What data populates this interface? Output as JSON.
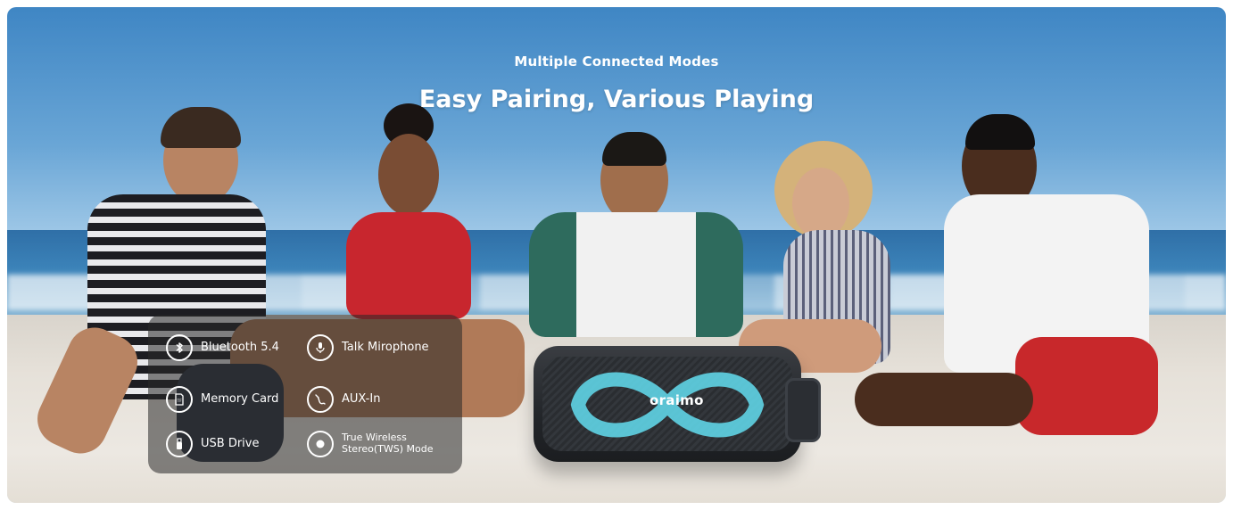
{
  "banner": {
    "eyebrow": "Multiple Connected Modes",
    "headline": "Easy Pairing, Various Playing"
  },
  "features": [
    {
      "icon": "bluetooth-icon",
      "label": "Bluetooth 5.4"
    },
    {
      "icon": "microphone-icon",
      "label": "Talk Mirophone"
    },
    {
      "icon": "memory-card-icon",
      "label": "Memory Card"
    },
    {
      "icon": "aux-cable-icon",
      "label": "AUX-In"
    },
    {
      "icon": "usb-drive-icon",
      "label": "USB Drive"
    },
    {
      "icon": "tws-icon",
      "label": "True Wireless Stereo(TWS) Mode"
    }
  ],
  "product": {
    "brand": "oraimo",
    "accent_color": "#5fd4e6"
  }
}
